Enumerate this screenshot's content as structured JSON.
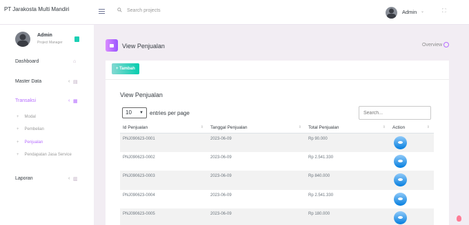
{
  "navbar": {
    "brand": "PT Jarakosta Multi Mandiri",
    "search_placeholder": "Search projects",
    "user": "Admin",
    "caret": "⌄",
    "expand": "⛶"
  },
  "sidebar": {
    "profile": {
      "name": "Admin",
      "role": "Project Manager"
    },
    "items": [
      {
        "label": "Dashboard",
        "icon": "home-icon",
        "glyph": "⌂"
      },
      {
        "label": "Master Data",
        "icon": "database-icon",
        "glyph": "▤",
        "chevron": "‹"
      },
      {
        "label": "Transaksi",
        "icon": "transaction-icon",
        "glyph": "▦",
        "chevron": "‹",
        "active": true
      },
      {
        "label": "Laporan",
        "icon": "report-icon",
        "glyph": "▥",
        "chevron": "‹"
      }
    ],
    "subitems": [
      {
        "label": "Modal"
      },
      {
        "label": "Pembelian"
      },
      {
        "label": "Penjualan",
        "active": true
      },
      {
        "label": "Pendapatan Jasa Service"
      }
    ],
    "sub_plus": "+"
  },
  "page_header": {
    "title": "View Penjualan",
    "overview": "Overview"
  },
  "card": {
    "add_button": "+ Tambah",
    "title": "View Penjualan",
    "entries_value": "10",
    "entries_label": "entries per page",
    "search_placeholder": "Search...",
    "sort_glyph": "⇕",
    "columns": [
      "Id Penjualan",
      "Tanggal Penjualan",
      "Total Penjualan",
      "Action"
    ],
    "rows": [
      {
        "id": "PNJ090623-0001",
        "tanggal": "2023-06-09",
        "total": "Rp 90.000"
      },
      {
        "id": "PNJ090623-0002",
        "tanggal": "2023-06-09",
        "total": "Rp 2.541.330"
      },
      {
        "id": "PNJ090623-0003",
        "tanggal": "2023-06-09",
        "total": "Rp 840.000"
      },
      {
        "id": "PNJ090623-0004",
        "tanggal": "2023-06-09",
        "total": "Rp 2.541.330"
      },
      {
        "id": "PNJ090623-0005",
        "tanggal": "2023-06-09",
        "total": "Rp 180.000"
      }
    ]
  },
  "colors": {
    "accent": "#b66dff",
    "success": "#1bcfb4",
    "info": "#047edf",
    "background": "#f2edf3"
  }
}
